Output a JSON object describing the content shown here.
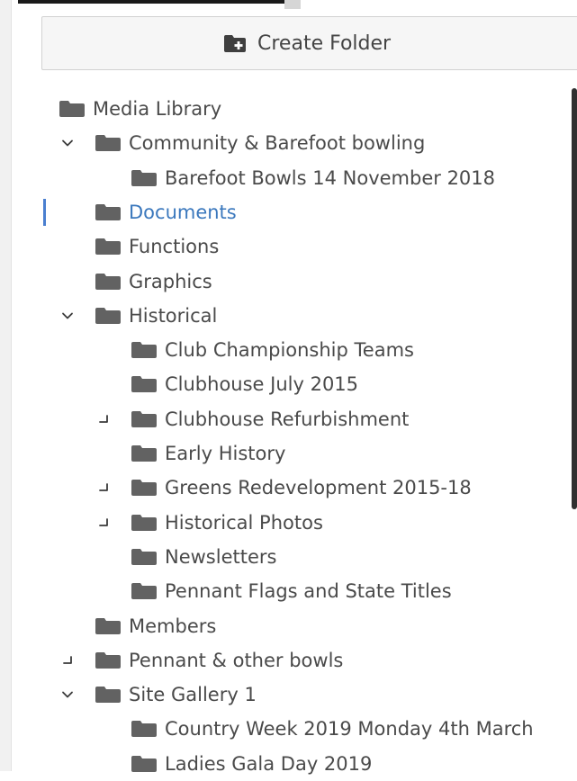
{
  "toolbar": {
    "create_folder_label": "Create Folder",
    "create_folder_icon": "folder-plus-icon"
  },
  "colors": {
    "folder": "#626262",
    "active_text": "#3b78bd",
    "active_bar": "#4a7fd0",
    "text": "#4a4a4a"
  },
  "tree": {
    "items": [
      {
        "label": "Media Library",
        "depth": 0,
        "toggle": "none",
        "active": false
      },
      {
        "label": "Community & Barefoot bowling",
        "depth": 1,
        "toggle": "expanded",
        "active": false
      },
      {
        "label": "Barefoot Bowls 14 November 2018",
        "depth": 2,
        "toggle": "none",
        "active": false
      },
      {
        "label": "Documents",
        "depth": 1,
        "toggle": "none",
        "active": true
      },
      {
        "label": "Functions",
        "depth": 1,
        "toggle": "none",
        "active": false
      },
      {
        "label": "Graphics",
        "depth": 1,
        "toggle": "none",
        "active": false
      },
      {
        "label": "Historical",
        "depth": 1,
        "toggle": "expanded",
        "active": false
      },
      {
        "label": "Club Championship Teams",
        "depth": 2,
        "toggle": "none",
        "active": false
      },
      {
        "label": "Clubhouse July 2015",
        "depth": 2,
        "toggle": "none",
        "active": false
      },
      {
        "label": "Clubhouse Refurbishment",
        "depth": 2,
        "toggle": "collapsed",
        "active": false
      },
      {
        "label": "Early History",
        "depth": 2,
        "toggle": "none",
        "active": false
      },
      {
        "label": "Greens Redevelopment 2015-18",
        "depth": 2,
        "toggle": "collapsed",
        "active": false
      },
      {
        "label": "Historical Photos",
        "depth": 2,
        "toggle": "collapsed",
        "active": false
      },
      {
        "label": "Newsletters",
        "depth": 2,
        "toggle": "none",
        "active": false
      },
      {
        "label": "Pennant Flags and State Titles",
        "depth": 2,
        "toggle": "none",
        "active": false
      },
      {
        "label": "Members",
        "depth": 1,
        "toggle": "none",
        "active": false
      },
      {
        "label": "Pennant & other bowls",
        "depth": 1,
        "toggle": "collapsed",
        "active": false
      },
      {
        "label": "Site Gallery 1",
        "depth": 1,
        "toggle": "expanded",
        "active": false
      },
      {
        "label": "Country Week 2019 Monday 4th March",
        "depth": 2,
        "toggle": "none",
        "active": false
      },
      {
        "label": "Ladies Gala Day 2019",
        "depth": 2,
        "toggle": "none",
        "active": false
      }
    ]
  }
}
